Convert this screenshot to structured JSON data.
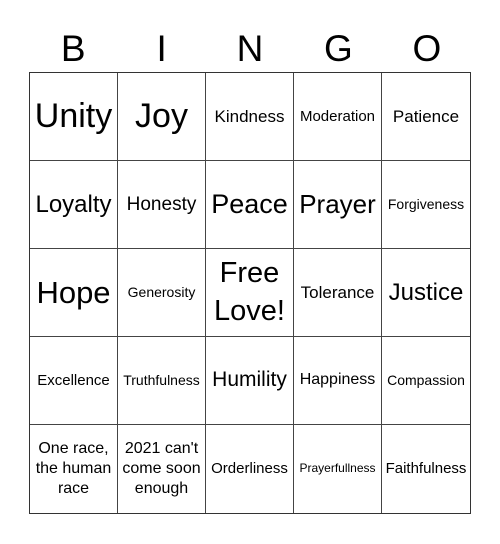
{
  "header": {
    "letters": [
      "B",
      "I",
      "N",
      "G",
      "O"
    ]
  },
  "grid": {
    "rows": [
      [
        "Unity",
        "Joy",
        "Kindness",
        "Moderation",
        "Patience"
      ],
      [
        "Loyalty",
        "Honesty",
        "Peace",
        "Prayer",
        "Forgiveness"
      ],
      [
        "Hope",
        "Generosity",
        "Free Love!",
        "Tolerance",
        "Justice"
      ],
      [
        "Excellence",
        "Truthfulness",
        "Humility",
        "Happiness",
        "Compassion"
      ],
      [
        "One race, the human race",
        "2021 can't come soon enough",
        "Orderliness",
        "Prayerfullness",
        "Faithfulness"
      ]
    ]
  }
}
